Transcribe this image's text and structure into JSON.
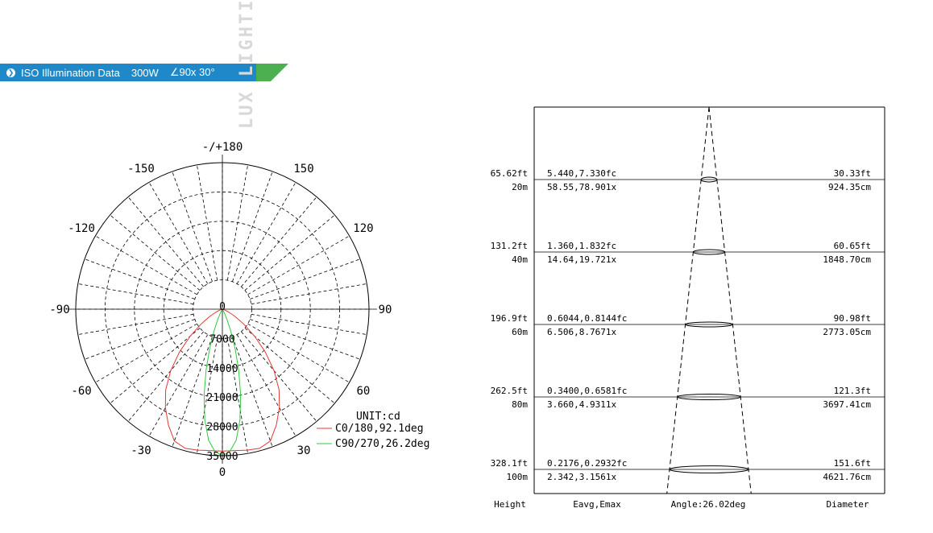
{
  "header": {
    "title": "ISO Illumination  Data",
    "power": "300W",
    "angle": "∠90x 30°",
    "colors": {
      "blue": "#1e88c8",
      "green": "#4caf50"
    },
    "icon": "circle-chevron-right-icon"
  },
  "watermark": {
    "text": "LUX LIGHTING"
  },
  "chart_data": [
    {
      "type": "polar",
      "unit_label": "UNIT:cd",
      "angle_labels": [
        "-/+180",
        "150",
        "120",
        "90",
        "60",
        "30",
        "0",
        "-30",
        "-60",
        "-90",
        "-120",
        "-150"
      ],
      "radial_labels": [
        "0",
        "7000",
        "14000",
        "21000",
        "28000",
        "35000"
      ],
      "rmax": 35000,
      "series": [
        {
          "name": "C0/180,92.1deg",
          "color": "#e53935",
          "points": [
            [
              0,
              33900
            ],
            [
              5,
              33900
            ],
            [
              10,
              34200
            ],
            [
              15,
              34400
            ],
            [
              20,
              33500
            ],
            [
              25,
              30500
            ],
            [
              30,
              27200
            ],
            [
              35,
              23600
            ],
            [
              40,
              19200
            ],
            [
              45,
              14500
            ],
            [
              50,
              10000
            ],
            [
              55,
              6300
            ],
            [
              60,
              3600
            ],
            [
              65,
              1800
            ],
            [
              70,
              700
            ],
            [
              75,
              200
            ],
            [
              80,
              60
            ],
            [
              85,
              0
            ],
            [
              90,
              0
            ],
            [
              -5,
              33900
            ],
            [
              -10,
              34200
            ],
            [
              -15,
              34400
            ],
            [
              -20,
              33500
            ],
            [
              -25,
              30500
            ],
            [
              -30,
              27200
            ],
            [
              -35,
              23600
            ],
            [
              -40,
              19200
            ],
            [
              -45,
              14500
            ],
            [
              -50,
              10000
            ],
            [
              -55,
              6300
            ],
            [
              -60,
              3600
            ],
            [
              -65,
              1800
            ],
            [
              -70,
              700
            ],
            [
              -75,
              200
            ],
            [
              -80,
              60
            ],
            [
              -85,
              0
            ],
            [
              -90,
              0
            ]
          ]
        },
        {
          "name": "C90/270,26.2deg",
          "color": "#2ecc40",
          "points": [
            [
              0,
              35000
            ],
            [
              3,
              34000
            ],
            [
              6,
              31500
            ],
            [
              9,
              26800
            ],
            [
              12,
              21000
            ],
            [
              15,
              15000
            ],
            [
              18,
              9800
            ],
            [
              21,
              5600
            ],
            [
              24,
              2800
            ],
            [
              27,
              1000
            ],
            [
              30,
              300
            ],
            [
              35,
              0
            ],
            [
              -3,
              34000
            ],
            [
              -6,
              31500
            ],
            [
              -9,
              26800
            ],
            [
              -12,
              21000
            ],
            [
              -15,
              15000
            ],
            [
              -18,
              9800
            ],
            [
              -21,
              5600
            ],
            [
              -24,
              2800
            ],
            [
              -27,
              1000
            ],
            [
              -30,
              300
            ],
            [
              -35,
              0
            ]
          ]
        }
      ]
    },
    {
      "type": "table",
      "angle_label": "Angle:26.02deg",
      "columns": [
        "Height",
        "Eavg,Emax",
        "Angle:26.02deg",
        "Diameter"
      ],
      "rows": [
        {
          "height_ft": "65.62ft",
          "height_m": "20m",
          "fc": "5.440,7.330fc",
          "lx": "58.55,78.901x",
          "dia_ft": "30.33ft",
          "dia_cm": "924.35cm",
          "diameter_m": 9.24
        },
        {
          "height_ft": "131.2ft",
          "height_m": "40m",
          "fc": "1.360,1.832fc",
          "lx": "14.64,19.721x",
          "dia_ft": "60.65ft",
          "dia_cm": "1848.70cm",
          "diameter_m": 18.49
        },
        {
          "height_ft": "196.9ft",
          "height_m": "60m",
          "fc": "0.6044,0.8144fc",
          "lx": "6.506,8.7671x",
          "dia_ft": "90.98ft",
          "dia_cm": "2773.05cm",
          "diameter_m": 27.73
        },
        {
          "height_ft": "262.5ft",
          "height_m": "80m",
          "fc": "0.3400,0.6581fc",
          "lx": "3.660,4.9311x",
          "dia_ft": "121.3ft",
          "dia_cm": "3697.41cm",
          "diameter_m": 36.97
        },
        {
          "height_ft": "328.1ft",
          "height_m": "100m",
          "fc": "0.2176,0.2932fc",
          "lx": "2.342,3.1561x",
          "dia_ft": "151.6ft",
          "dia_cm": "4621.76cm",
          "diameter_m": 46.22
        }
      ]
    }
  ]
}
